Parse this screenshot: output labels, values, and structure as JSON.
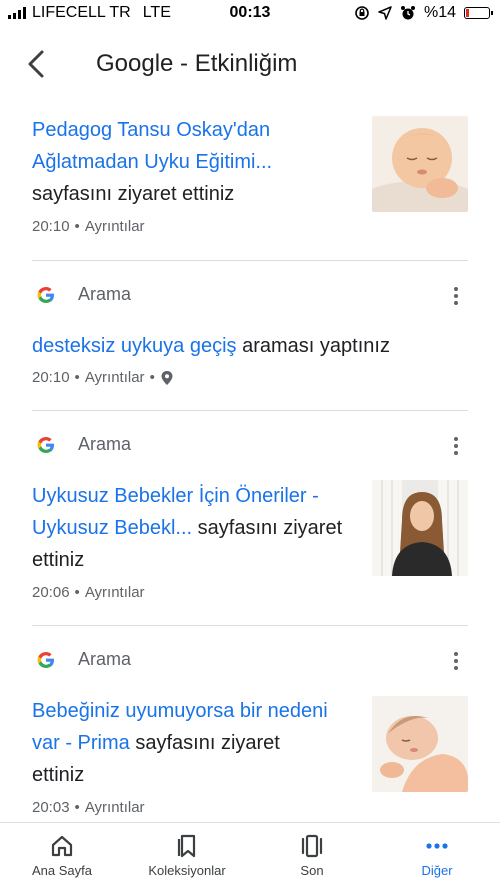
{
  "status": {
    "carrier": "LIFECELL TR",
    "network": "LTE",
    "time": "00:13",
    "battery": "%14",
    "battery_level": 0.14,
    "battery_color": "#e0291f"
  },
  "header": {
    "title": "Google - Etkinliğim"
  },
  "items": [
    {
      "link": "Pedagog Tansu Oskay'dan Ağlatmadan Uyku Eğitimi...",
      "suffix": "sayfasını ziyaret ettiniz",
      "time": "20:10",
      "details": "Ayrıntılar"
    },
    {
      "source": "Arama",
      "link": "desteksiz uykuya geçiş",
      "suffix": "araması yaptınız",
      "time": "20:10",
      "details": "Ayrıntılar"
    },
    {
      "source": "Arama",
      "link": "Uykusuz Bebekler İçin Öneriler - Uykusuz Bebekl...",
      "suffix": "sayfasını ziyaret ettiniz",
      "time": "20:06",
      "details": "Ayrıntılar"
    },
    {
      "source": "Arama",
      "link": "Bebeğiniz uyumuyorsa bir nedeni var - Prima",
      "suffix": "sayfasını ziyaret ettiniz",
      "time": "20:03",
      "details": "Ayrıntılar"
    }
  ],
  "nav": {
    "home": "Ana Sayfa",
    "collections": "Koleksiyonlar",
    "recent": "Son",
    "more": "Diğer"
  },
  "colors": {
    "accent": "#1a73e8",
    "text": "#202124",
    "muted": "#5f6368"
  }
}
